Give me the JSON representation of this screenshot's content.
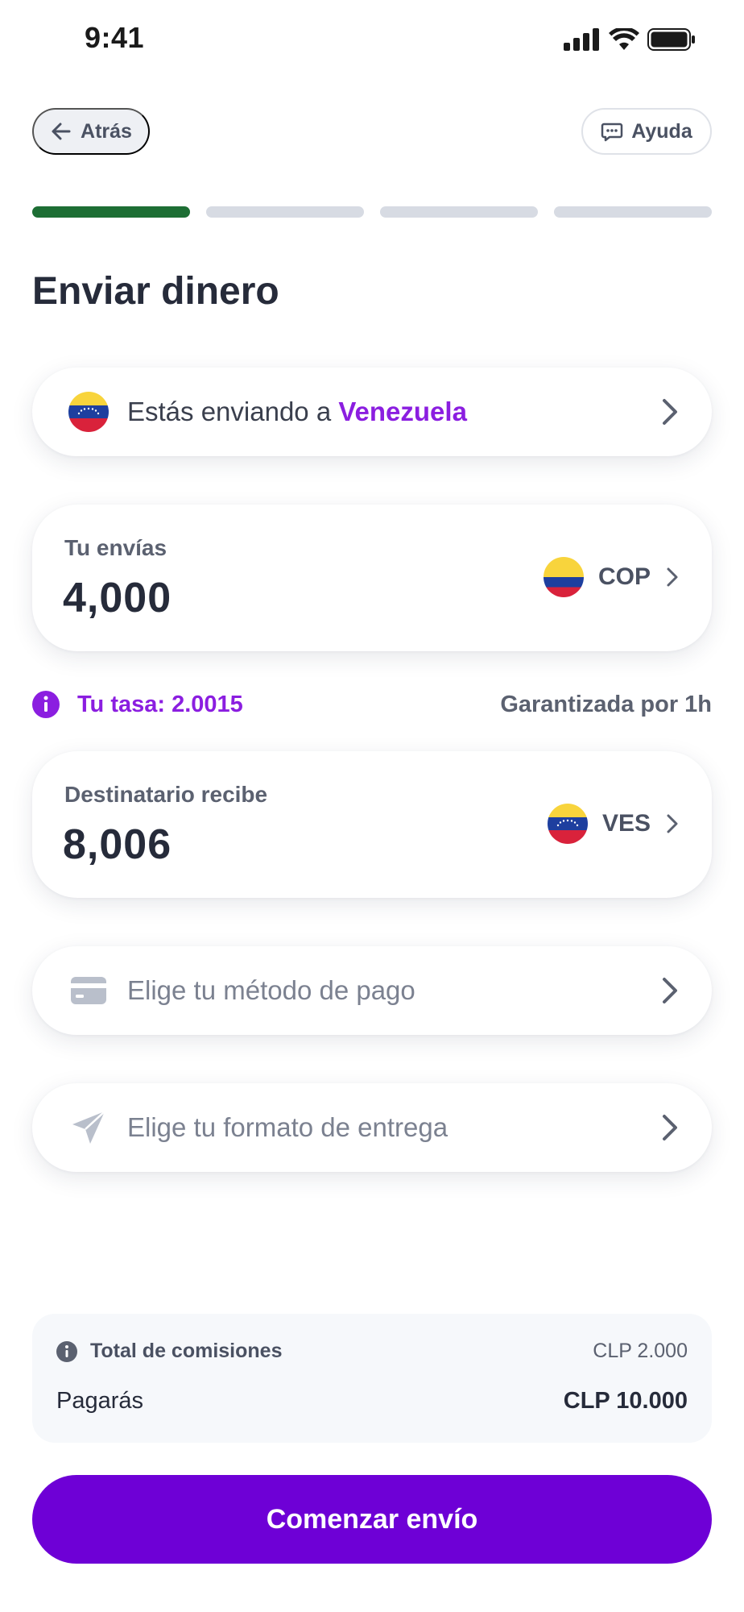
{
  "status_bar": {
    "time": "9:41"
  },
  "nav": {
    "back_label": "Atrás",
    "help_label": "Ayuda"
  },
  "progress": {
    "total_steps": 4,
    "current_step": 1
  },
  "page": {
    "title": "Enviar dinero"
  },
  "destination": {
    "prefix": "Estás enviando a",
    "country": "Venezuela"
  },
  "send": {
    "label": "Tu envías",
    "amount": "4,000",
    "currency": "COP"
  },
  "rate": {
    "text": "Tu tasa: 2.0015",
    "guarantee": "Garantizada por 1h"
  },
  "receive": {
    "label": "Destinatario recibe",
    "amount": "8,006",
    "currency": "VES"
  },
  "payment_method": {
    "placeholder": "Elige tu método de pago"
  },
  "delivery_format": {
    "placeholder": "Elige tu formato de entrega"
  },
  "fees": {
    "total_label": "Total de comisiones",
    "total_value": "CLP 2.000",
    "pay_label": "Pagarás",
    "pay_value": "CLP 10.000"
  },
  "cta": {
    "label": "Comenzar envío"
  },
  "colors": {
    "accent": "#8b1ee0",
    "cta": "#6e00d6",
    "progress_active": "#1d6e34",
    "progress_inactive": "#d7dbe3"
  },
  "icons": {
    "back": "arrow-left-icon",
    "help": "chat-bubble-icon",
    "venezuela_flag": "venezuela-flag-icon",
    "colombia_flag": "colombia-flag-icon",
    "chevron": "chevron-right-icon",
    "info": "info-icon",
    "card": "credit-card-icon",
    "send": "paper-plane-icon"
  }
}
